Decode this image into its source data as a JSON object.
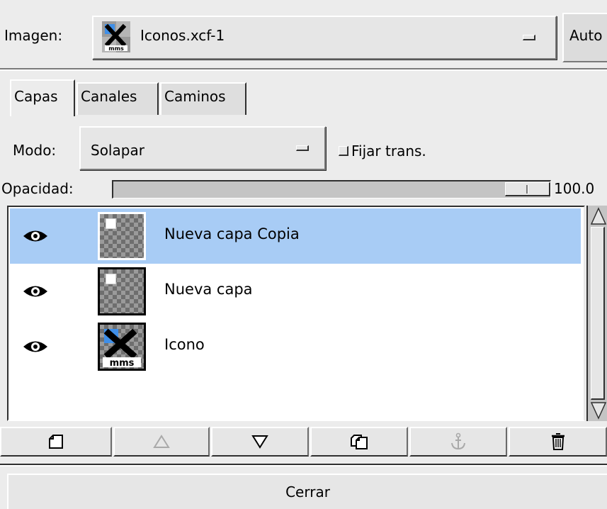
{
  "image_selector": {
    "label": "Imagen:",
    "value": "Iconos.xcf-1",
    "auto_button_label": "Auto"
  },
  "tabs": [
    {
      "label": "Capas",
      "active": true
    },
    {
      "label": "Canales",
      "active": false
    },
    {
      "label": "Caminos",
      "active": false
    }
  ],
  "mode": {
    "label": "Modo:",
    "value": "Solapar",
    "keep_trans_label": "Fijar trans.",
    "keep_trans_checked": false
  },
  "opacity": {
    "label": "Opacidad:",
    "value": "100.0",
    "fraction": 1.0
  },
  "layers": [
    {
      "name": "Nueva capa Copia",
      "visible": true,
      "selected": true,
      "thumbnail": "white-square-on-transparent"
    },
    {
      "name": "Nueva capa",
      "visible": true,
      "selected": false,
      "thumbnail": "white-square-on-transparent"
    },
    {
      "name": "Icono",
      "visible": true,
      "selected": false,
      "thumbnail": "x-mms-icon"
    }
  ],
  "layer_buttons": [
    {
      "icon": "new-layer-icon",
      "enabled": true
    },
    {
      "icon": "raise-layer-icon",
      "enabled": false
    },
    {
      "icon": "lower-layer-icon",
      "enabled": true
    },
    {
      "icon": "duplicate-layer-icon",
      "enabled": true
    },
    {
      "icon": "anchor-icon",
      "enabled": false
    },
    {
      "icon": "trash-icon",
      "enabled": true
    }
  ],
  "close_button_label": "Cerrar",
  "colors": {
    "selection": "#a8ccf5",
    "icon_blue": "#3f8fe8"
  }
}
